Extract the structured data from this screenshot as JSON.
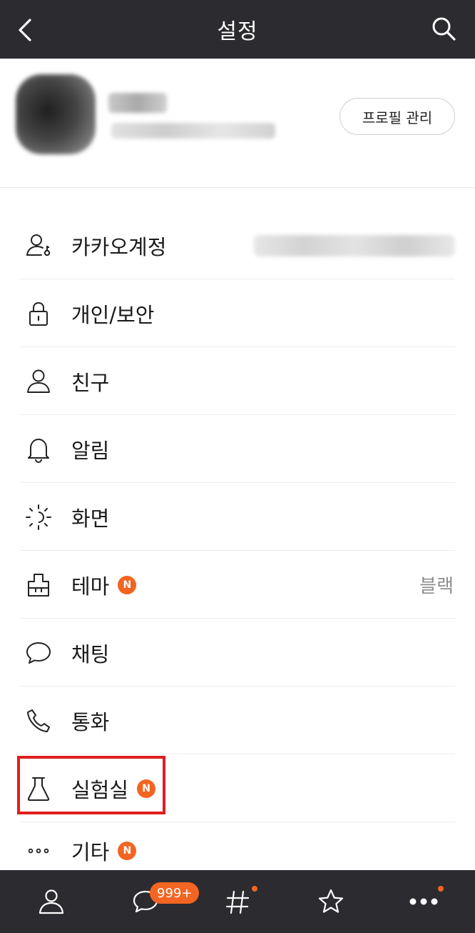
{
  "header": {
    "title": "설정",
    "back_icon": "chevron-left-icon",
    "search_icon": "search-icon"
  },
  "profile": {
    "manage_button": "프로필 관리"
  },
  "menu": [
    {
      "label": "카카오계정",
      "icon": "account-key-icon"
    },
    {
      "label": "개인/보안",
      "icon": "lock-icon"
    },
    {
      "label": "친구",
      "icon": "person-icon"
    },
    {
      "label": "알림",
      "icon": "bell-icon"
    },
    {
      "label": "화면",
      "icon": "brightness-icon"
    },
    {
      "label": "테마",
      "icon": "theme-brush-icon",
      "badge": "N",
      "value": "블랙"
    },
    {
      "label": "채팅",
      "icon": "chat-bubble-icon"
    },
    {
      "label": "통화",
      "icon": "phone-icon"
    },
    {
      "label": "실험실",
      "icon": "flask-icon",
      "badge": "N"
    },
    {
      "label": "기타",
      "icon": "more-dots-icon",
      "badge": "N"
    }
  ],
  "tabbar": {
    "friends_icon": "person-icon",
    "chats_icon": "chat-bubble-icon",
    "chats_badge": "999+",
    "hashtag_icon": "hashtag-icon",
    "star_icon": "star-icon",
    "more_icon": "more-dots-icon"
  },
  "colors": {
    "header_bg": "#2b2b30",
    "accent": "#f26522",
    "highlight": "#e01e1e"
  }
}
